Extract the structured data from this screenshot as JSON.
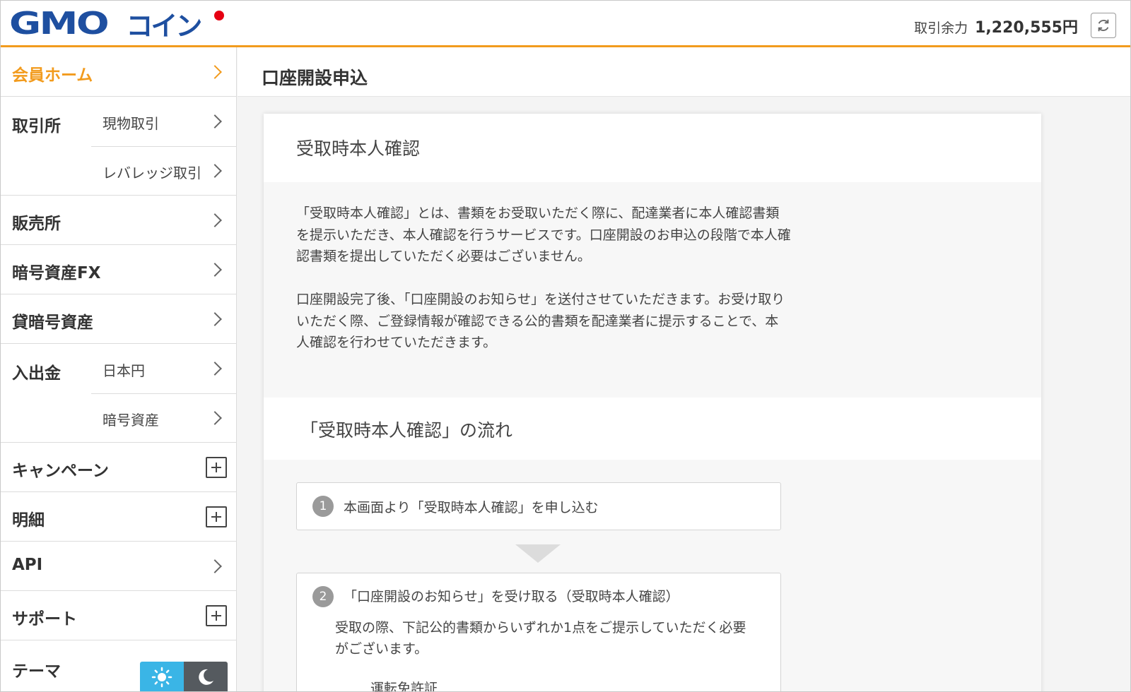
{
  "header": {
    "logo_latin": "GMO",
    "logo_kana": "コイン",
    "balance_label": "取引余力",
    "balance_value": "1,220,555円"
  },
  "colors": {
    "accent": "#f29b1d",
    "brand": "#1e4fa0",
    "logo_dot": "#e60012",
    "theme_light": "#3ab5e6",
    "theme_dark": "#555a5f"
  },
  "sidebar": {
    "home": "会員ホーム",
    "exchange": {
      "label": "取引所",
      "items": [
        "現物取引",
        "レバレッジ取引"
      ]
    },
    "sales": "販売所",
    "crypto_fx": "暗号資産FX",
    "lending": "貸暗号資産",
    "deposit": {
      "label": "入出金",
      "items": [
        "日本円",
        "暗号資産"
      ]
    },
    "campaign": "キャンペーン",
    "statement": "明細",
    "api": "API",
    "support": "サポート",
    "theme": "テーマ"
  },
  "main": {
    "page_title": "口座開設申込",
    "card_title": "受取時本人確認",
    "description": [
      "「受取時本人確認」とは、書類をお受取いただく際に、配達業者に本人確認書類を提示いただき、本人確認を行うサービスです。口座開設のお申込の段階で本人確認書類を提出していただく必要はございません。",
      "口座開設完了後、「口座開設のお知らせ」を送付させていただきます。お受け取りいただく際、ご登録情報が確認できる公的書類を配達業者に提示することで、本人確認を行わせていただきます。"
    ],
    "flow_title": "「受取時本人確認」の流れ",
    "steps": [
      {
        "num": "1",
        "text": "本画面より「受取時本人確認」を申し込む"
      },
      {
        "num": "2",
        "text": "「口座開設のお知らせ」を受け取る（受取時本人確認）",
        "detail": "受取の際、下記公的書類からいずれか1点をご提示していただく必要がございます。",
        "cut_text": "運転免許証"
      }
    ]
  }
}
